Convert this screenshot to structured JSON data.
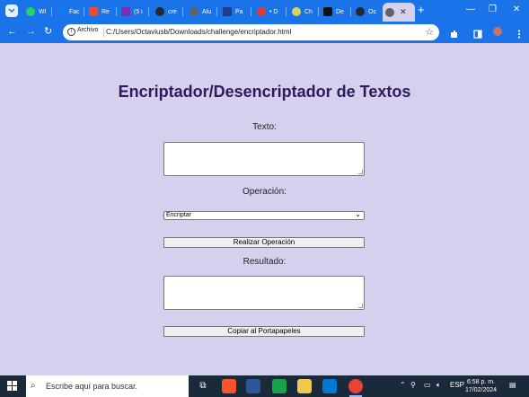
{
  "browser": {
    "tabs": [
      {
        "label": "WI",
        "favicon_color": "#25d366",
        "icon": "whatsapp-icon"
      },
      {
        "label": "Fac",
        "favicon_color": "#1877f2",
        "icon": "facebook-icon"
      },
      {
        "label": "Re",
        "favicon_color": "#e94e2c",
        "icon": "pinwheel-icon"
      },
      {
        "label": "(5 i",
        "favicon_color": "#7b2fb5",
        "icon": "mail-icon"
      },
      {
        "label": "cre",
        "favicon_color": "#24292e",
        "icon": "github-icon"
      },
      {
        "label": "Alu",
        "favicon_color": "#5f6368",
        "icon": "globe-icon"
      },
      {
        "label": "Pa",
        "favicon_color": "#1a3d8f",
        "icon": "alura-icon"
      },
      {
        "label": "• D",
        "favicon_color": "#e53935",
        "icon": "record-icon"
      },
      {
        "label": "Ch",
        "favicon_color": "#d9d45f",
        "icon": "chatgpt-icon"
      },
      {
        "label": "De",
        "favicon_color": "#111111",
        "icon": "a-logo-icon"
      },
      {
        "label": "Oc",
        "favicon_color": "#24292e",
        "icon": "github-icon"
      }
    ],
    "active_tab_close": "✕",
    "new_tab": "+",
    "window_controls": {
      "minimize": "—",
      "restore": "❐",
      "close": "✕"
    },
    "address": {
      "chip": "Archivo",
      "url": "C:/Users/Octaviusb/Downloads/challenge/encriptador.html"
    }
  },
  "app": {
    "title": "Encriptador/Desencriptador de Textos",
    "text_label": "Texto:",
    "text_value": "",
    "operation_label": "Operación:",
    "operation_selected": "Encriptar",
    "run_button": "Realizar Operación",
    "result_label": "Resultado:",
    "result_value": "",
    "copy_button": "Copiar al Portapapeles"
  },
  "taskbar": {
    "search_placeholder": "Escribe aquí para buscar.",
    "language": "ESP",
    "time": "6:58 p. m.",
    "date": "17/02/2024"
  },
  "colors": {
    "browser_frame": "#1a73e8",
    "page_background": "#d6d0ef",
    "title_color": "#2f1a5c",
    "taskbar": "#1b2a3a"
  }
}
